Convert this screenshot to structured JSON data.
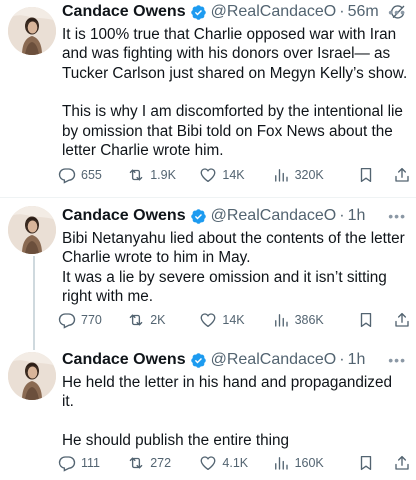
{
  "tweets": [
    {
      "name": "Candace Owens",
      "handle": "@RealCandaceO",
      "dot": "·",
      "time": "56m",
      "paragraphs": [
        "It is 100% true that Charlie opposed war with Iran and was fighting with his donors over Israel— as Tucker Carlson just shared on Megyn Kelly’s show.",
        "This is why I am discomforted by the intentional lie by omission that Bibi told on Fox News about the letter Charlie wrote him."
      ],
      "replies": "655",
      "reposts": "1.9K",
      "likes": "14K",
      "views": "320K"
    },
    {
      "name": "Candace Owens",
      "handle": "@RealCandaceO",
      "dot": "·",
      "time": "1h",
      "paragraphs": [
        "Bibi Netanyahu lied about the contents of the letter Charlie wrote to him in May.",
        "It was a lie by severe omission and it isn’t sitting right with me."
      ],
      "replies": "770",
      "reposts": "2K",
      "likes": "14K",
      "views": "386K"
    },
    {
      "name": "Candace Owens",
      "handle": "@RealCandaceO",
      "dot": "·",
      "time": "1h",
      "paragraphs": [
        "He held the letter in his hand and propagandized it.",
        "He should publish the entire thing"
      ],
      "replies": "111",
      "reposts": "272",
      "likes": "4.1K",
      "views": "160K"
    }
  ],
  "icons": {
    "verified": "verified-badge-icon",
    "grok": "grok-icon",
    "more": "more-icon",
    "reply": "reply-icon",
    "repost": "repost-icon",
    "like": "like-icon",
    "views": "views-icon",
    "bookmark": "bookmark-icon",
    "share": "share-icon"
  },
  "colors": {
    "verified": "#1d9bf0",
    "text": "#0f1419",
    "secondary": "#536471",
    "thread_line": "#cfd9de"
  }
}
